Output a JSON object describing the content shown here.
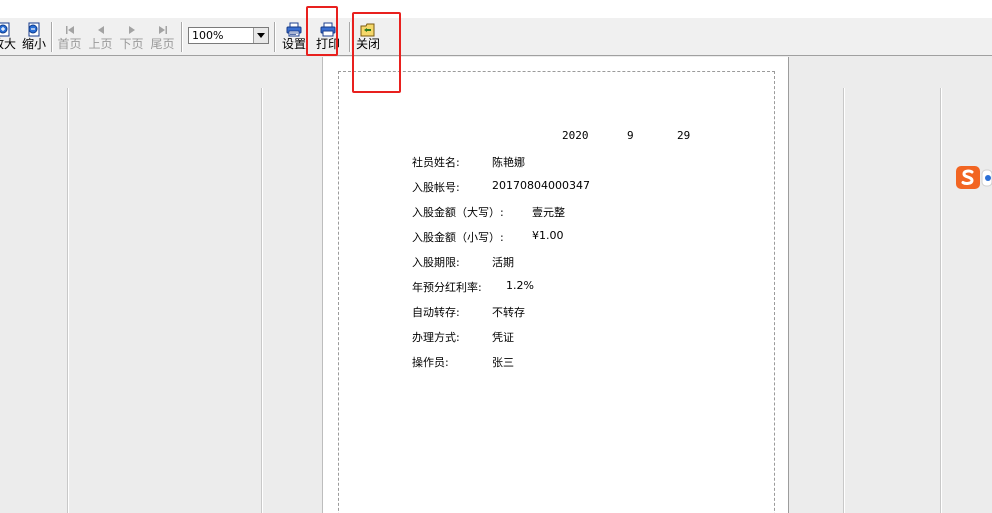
{
  "toolbar": {
    "zoom_in_label": "放大",
    "zoom_out_label": "缩小",
    "first_label": "首页",
    "prev_label": "上页",
    "next_label": "下页",
    "last_label": "尾页",
    "zoom_value": "100%",
    "setup_label": "设置",
    "print_label": "打印",
    "close_label": "关闭"
  },
  "document": {
    "date": {
      "year": "2020",
      "month": "9",
      "day": "29"
    },
    "fields": [
      {
        "label": "社员姓名:",
        "value": "陈艳娜"
      },
      {
        "label": "入股帐号:",
        "value": "20170804000347"
      },
      {
        "label": "入股金额（大写）:",
        "value": "壹元整"
      },
      {
        "label": "入股金额（小写）:",
        "value": "¥1.00"
      },
      {
        "label": "入股期限:",
        "value": "活期"
      },
      {
        "label": "年预分红利率:",
        "value": "1.2%"
      },
      {
        "label": "自动转存:",
        "value": "不转存"
      },
      {
        "label": "办理方式:",
        "value": "凭证"
      },
      {
        "label": "操作员:",
        "value": "张三"
      }
    ]
  },
  "colors": {
    "highlight": "#e8201e",
    "ime_logo": "#f26522"
  }
}
